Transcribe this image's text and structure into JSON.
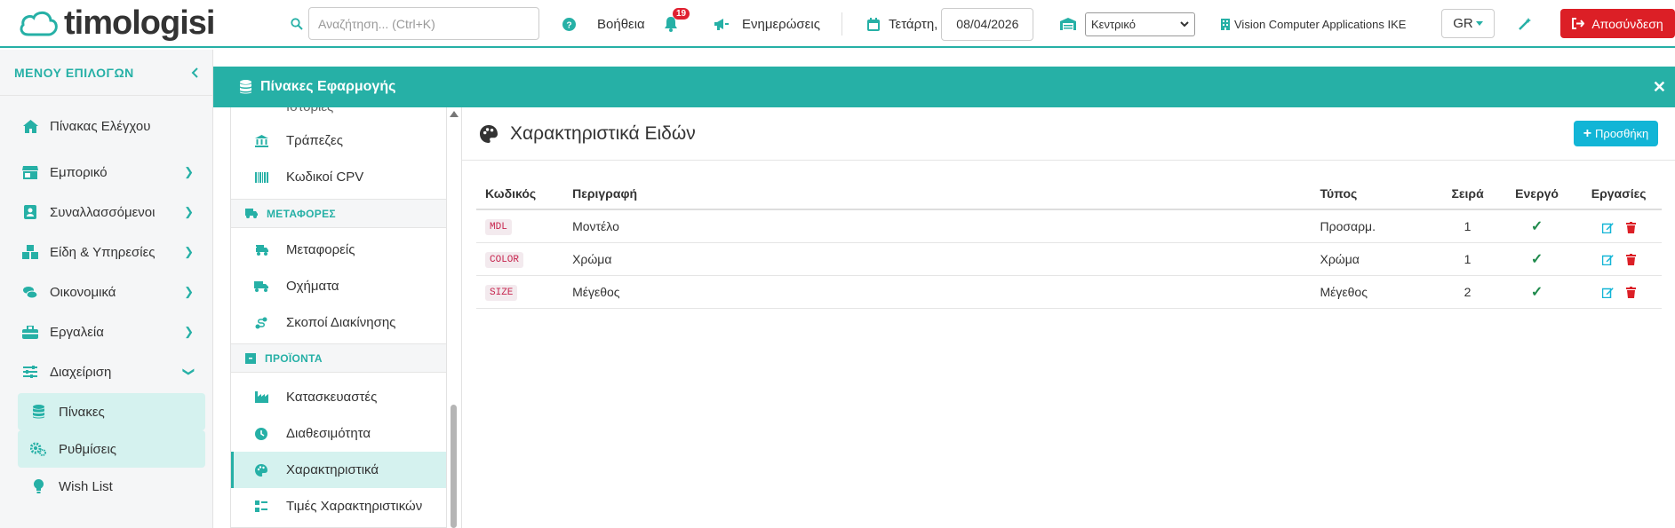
{
  "brand": {
    "name": "timologisi"
  },
  "header": {
    "search_placeholder": "Αναζήτηση... (Ctrl+K)",
    "help_label": "Βοήθεια",
    "notifications_count": "19",
    "updates_label": "Ενημερώσεις",
    "day_label": "Τετάρτη,",
    "date_value": "08/04/2026",
    "branch_selected": "Κεντρικό",
    "company_name": "Vision Computer Applications IKE",
    "language": "GR",
    "logout_label": "Αποσύνδεση"
  },
  "sidebar": {
    "title": "ΜΕΝΟΥ ΕΠΙΛΟΓΩΝ",
    "items": [
      {
        "label": "Πίνακας Ελέγχου",
        "icon": "home-icon"
      },
      {
        "label": "Εμπορικό",
        "icon": "shop-icon"
      },
      {
        "label": "Συναλλασσόμενοι",
        "icon": "contact-icon"
      },
      {
        "label": "Είδη & Υπηρεσίες",
        "icon": "boxes-icon"
      },
      {
        "label": "Οικονομικά",
        "icon": "coins-icon"
      },
      {
        "label": "Εργαλεία",
        "icon": "toolbox-icon"
      },
      {
        "label": "Διαχείριση",
        "icon": "sliders-icon"
      }
    ],
    "sub_items": [
      {
        "label": "Πίνακες",
        "icon": "database-icon"
      },
      {
        "label": "Ρυθμίσεις",
        "icon": "gears-icon"
      },
      {
        "label": "Wish List",
        "icon": "lightbulb-icon"
      }
    ]
  },
  "panel": {
    "title": "Πίνακες Εφαρμογής"
  },
  "midnav": {
    "partial_top": "Ιστορίες",
    "items_top": [
      {
        "label": "Τράπεζες",
        "icon": "bank-icon"
      },
      {
        "label": "Κωδικοί CPV",
        "icon": "barcode-icon"
      }
    ],
    "section_transport": "ΜΕΤΑΦΟΡΕΣ",
    "items_transport": [
      {
        "label": "Μεταφορείς",
        "icon": "truck-fast-icon"
      },
      {
        "label": "Οχήματα",
        "icon": "truck-icon"
      },
      {
        "label": "Σκοποί Διακίνησης",
        "icon": "route-icon"
      }
    ],
    "section_products": "ΠΡΟΪΟΝΤΑ",
    "items_products": [
      {
        "label": "Κατασκευαστές",
        "icon": "industry-icon"
      },
      {
        "label": "Διαθεσιμότητα",
        "icon": "clock-icon"
      },
      {
        "label": "Χαρακτηριστικά",
        "icon": "palette-icon"
      },
      {
        "label": "Τιμές Χαρακτηριστικών",
        "icon": "list-icon"
      }
    ]
  },
  "content": {
    "title": "Χαρακτηριστικά Ειδών",
    "add_label": "Προσθήκη",
    "columns": [
      "Κωδικός",
      "Περιγραφή",
      "Τύπος",
      "Σειρά",
      "Ενεργό",
      "Εργασίες"
    ],
    "rows": [
      {
        "code": "MDL",
        "description": "Μοντέλο",
        "type": "Προσαρμ.",
        "order": "1",
        "active": "✓"
      },
      {
        "code": "COLOR",
        "description": "Χρώμα",
        "type": "Χρώμα",
        "order": "1",
        "active": "✓"
      },
      {
        "code": "SIZE",
        "description": "Μέγεθος",
        "type": "Μέγεθος",
        "order": "2",
        "active": "✓"
      }
    ]
  },
  "colors": {
    "accent": "#26b0a6",
    "danger": "#dc1f26",
    "info": "#12b5d6"
  }
}
